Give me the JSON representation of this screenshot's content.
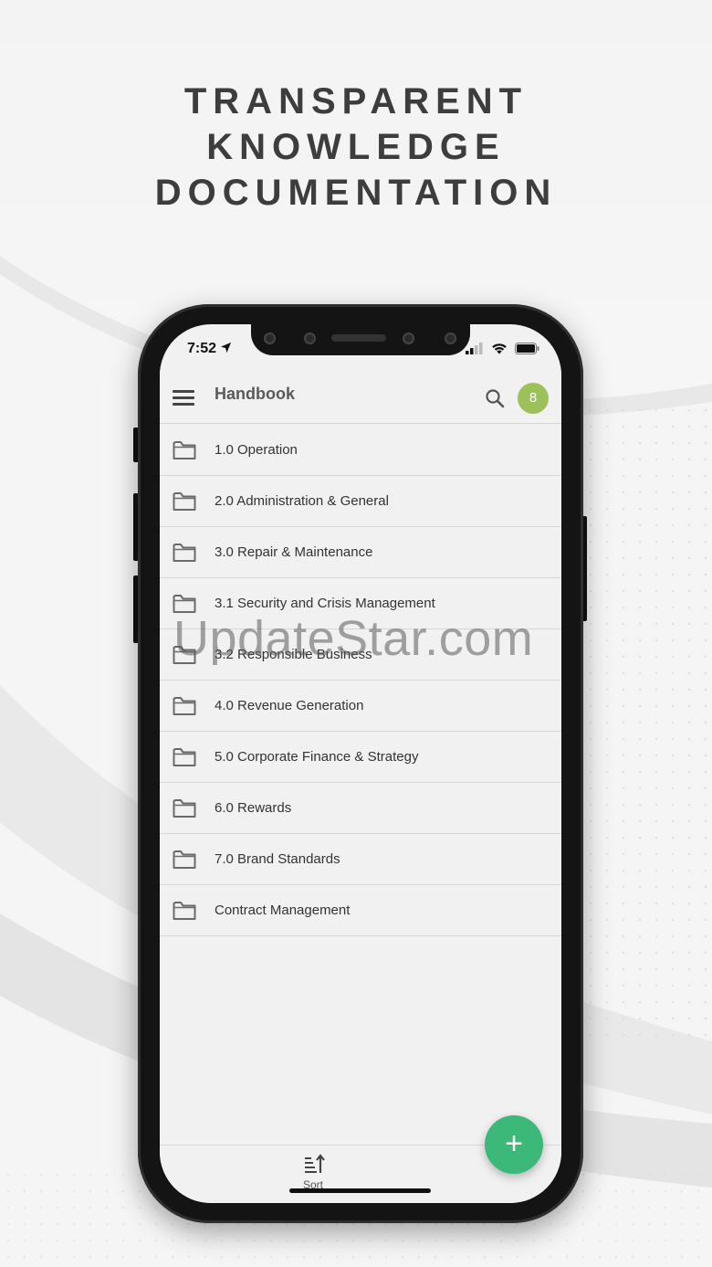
{
  "headline": {
    "line1": "TRANSPARENT",
    "line2": "KNOWLEDGE",
    "line3": "DOCUMENTATION"
  },
  "status_bar": {
    "time": "7:52",
    "icons": [
      "location-arrow-icon",
      "signal-icon",
      "wifi-icon",
      "battery-icon"
    ]
  },
  "app_bar": {
    "title": "Handbook",
    "notification_count": "8",
    "badge_color": "#9cc05a"
  },
  "folders": [
    {
      "label": "1.0 Operation"
    },
    {
      "label": "2.0 Administration & General"
    },
    {
      "label": "3.0 Repair & Maintenance"
    },
    {
      "label": "3.1 Security and Crisis Management"
    },
    {
      "label": "3.2 Responsible Business"
    },
    {
      "label": "4.0 Revenue Generation"
    },
    {
      "label": "5.0 Corporate Finance & Strategy"
    },
    {
      "label": "6.0 Rewards"
    },
    {
      "label": "7.0 Brand Standards"
    },
    {
      "label": "Contract Management"
    }
  ],
  "bottom_bar": {
    "sort_label": "Sort"
  },
  "fab": {
    "symbol": "+",
    "color": "#3cb878"
  },
  "watermark": "UpdateStar.com"
}
